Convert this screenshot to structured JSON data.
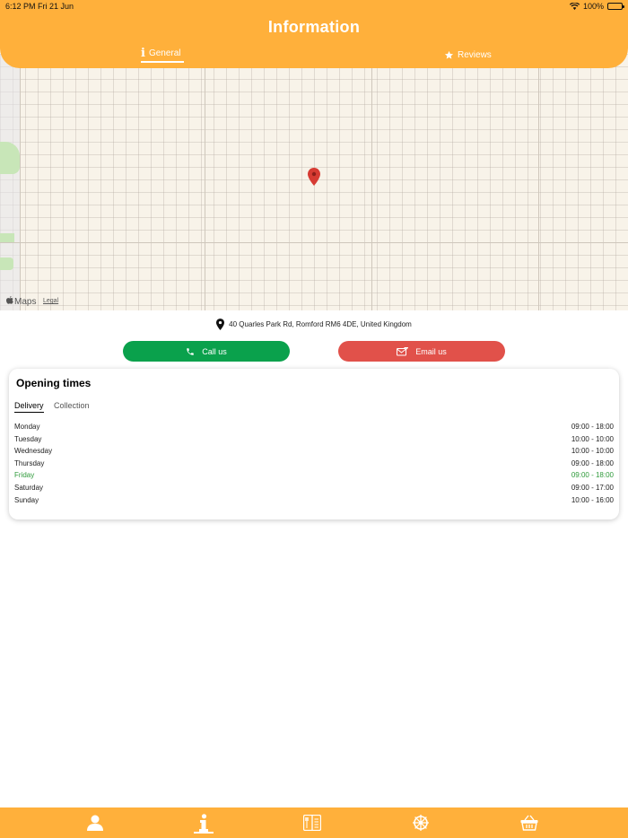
{
  "status_bar": {
    "time": "6:12 PM",
    "date": "Fri 21 Jun",
    "battery": "100%"
  },
  "header": {
    "title": "Information",
    "tabs": [
      {
        "label": "General",
        "icon": "info-icon",
        "active": true
      },
      {
        "label": "Reviews",
        "icon": "star-icon",
        "active": false
      }
    ]
  },
  "map": {
    "brand": "Maps",
    "legal": "Legal",
    "pin_icon": "map-pin-icon"
  },
  "address": {
    "text": "40 Quarles Park Rd, Romford RM6 4DE, United Kingdom",
    "icon": "location-pin-icon"
  },
  "actions": {
    "call": {
      "label": "Call us",
      "icon": "phone-icon",
      "color": "#0AA14C"
    },
    "email": {
      "label": "Email us",
      "icon": "email-icon",
      "color": "#E1514A"
    }
  },
  "opening_times": {
    "title": "Opening times",
    "tabs": [
      {
        "label": "Delivery",
        "active": true
      },
      {
        "label": "Collection",
        "active": false
      }
    ],
    "rows": [
      {
        "day": "Monday",
        "hours": "09:00 - 18:00"
      },
      {
        "day": "Tuesday",
        "hours": "10:00 - 10:00"
      },
      {
        "day": "Wednesday",
        "hours": "10:00 - 10:00"
      },
      {
        "day": "Thursday",
        "hours": "09:00 - 18:00"
      },
      {
        "day": "Friday",
        "hours": "09:00 - 18:00",
        "today": true
      },
      {
        "day": "Saturday",
        "hours": "09:00 - 17:00"
      },
      {
        "day": "Sunday",
        "hours": "10:00 - 16:00"
      }
    ],
    "today_color": "#2E9A3A"
  },
  "bottom_nav": {
    "items": [
      {
        "icon": "user-icon"
      },
      {
        "icon": "info-icon",
        "active": true
      },
      {
        "icon": "menu-icon"
      },
      {
        "icon": "wheel-icon"
      },
      {
        "icon": "basket-icon"
      }
    ]
  },
  "colors": {
    "accent": "#FFB03B"
  }
}
